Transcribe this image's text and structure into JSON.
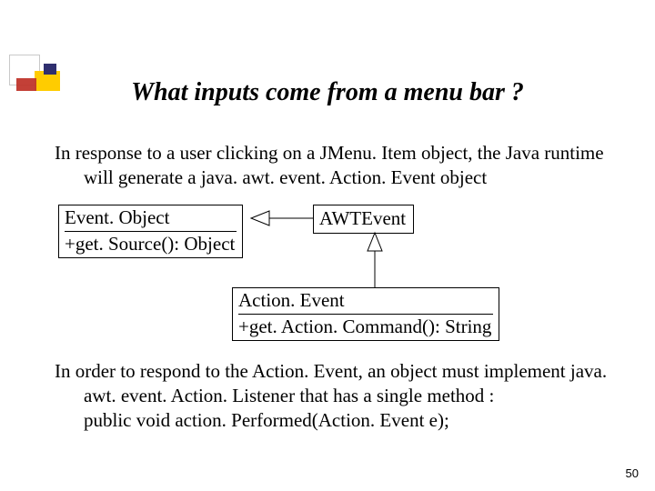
{
  "title": "What inputs come from a menu bar ?",
  "paragraph1": "In response to a user clicking on a JMenu. Item object, the Java runtime will generate a java. awt. event. Action. Event object",
  "paragraph2": "In order to respond to the Action. Event, an object must implement java. awt. event. Action. Listener that has a single method :\n public void action. Performed(Action. Event e);",
  "uml": {
    "eventObject": {
      "name": "Event. Object",
      "op": "+get. Source(): Object"
    },
    "awtEvent": {
      "name": "AWTEvent"
    },
    "actionEvent": {
      "name": "Action. Event",
      "op": "+get. Action. Command(): String"
    }
  },
  "pageNumber": "50"
}
